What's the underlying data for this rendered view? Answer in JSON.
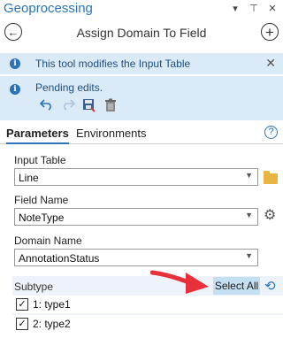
{
  "pane": {
    "title": "Geoprocessing",
    "header_icons": [
      "▾",
      "⊤",
      "✕"
    ]
  },
  "tool": {
    "title": "Assign Domain To Field",
    "back_icon": "←",
    "add_icon": "+"
  },
  "messages": {
    "info": "This tool modifies the Input Table",
    "pending": "Pending edits.",
    "close_icon": "✕"
  },
  "tabs": {
    "parameters": "Parameters",
    "environments": "Environments",
    "help_icon": "?"
  },
  "params": {
    "input_table": {
      "label": "Input Table",
      "value": "Line"
    },
    "field_name": {
      "label": "Field Name",
      "value": "NoteType"
    },
    "domain_name": {
      "label": "Domain Name",
      "value": "AnnotationStatus"
    },
    "subtype": {
      "label": "Subtype",
      "select_all": "Select All",
      "items": [
        {
          "label": "1: type1",
          "checked": "✓"
        },
        {
          "label": "2: type2",
          "checked": "✓"
        }
      ]
    }
  },
  "colors": {
    "accent": "#2a73b9",
    "message_bg": "#dbeaf7",
    "select_all_bg": "#c5dff2",
    "annotation_arrow": "#e8303a"
  }
}
